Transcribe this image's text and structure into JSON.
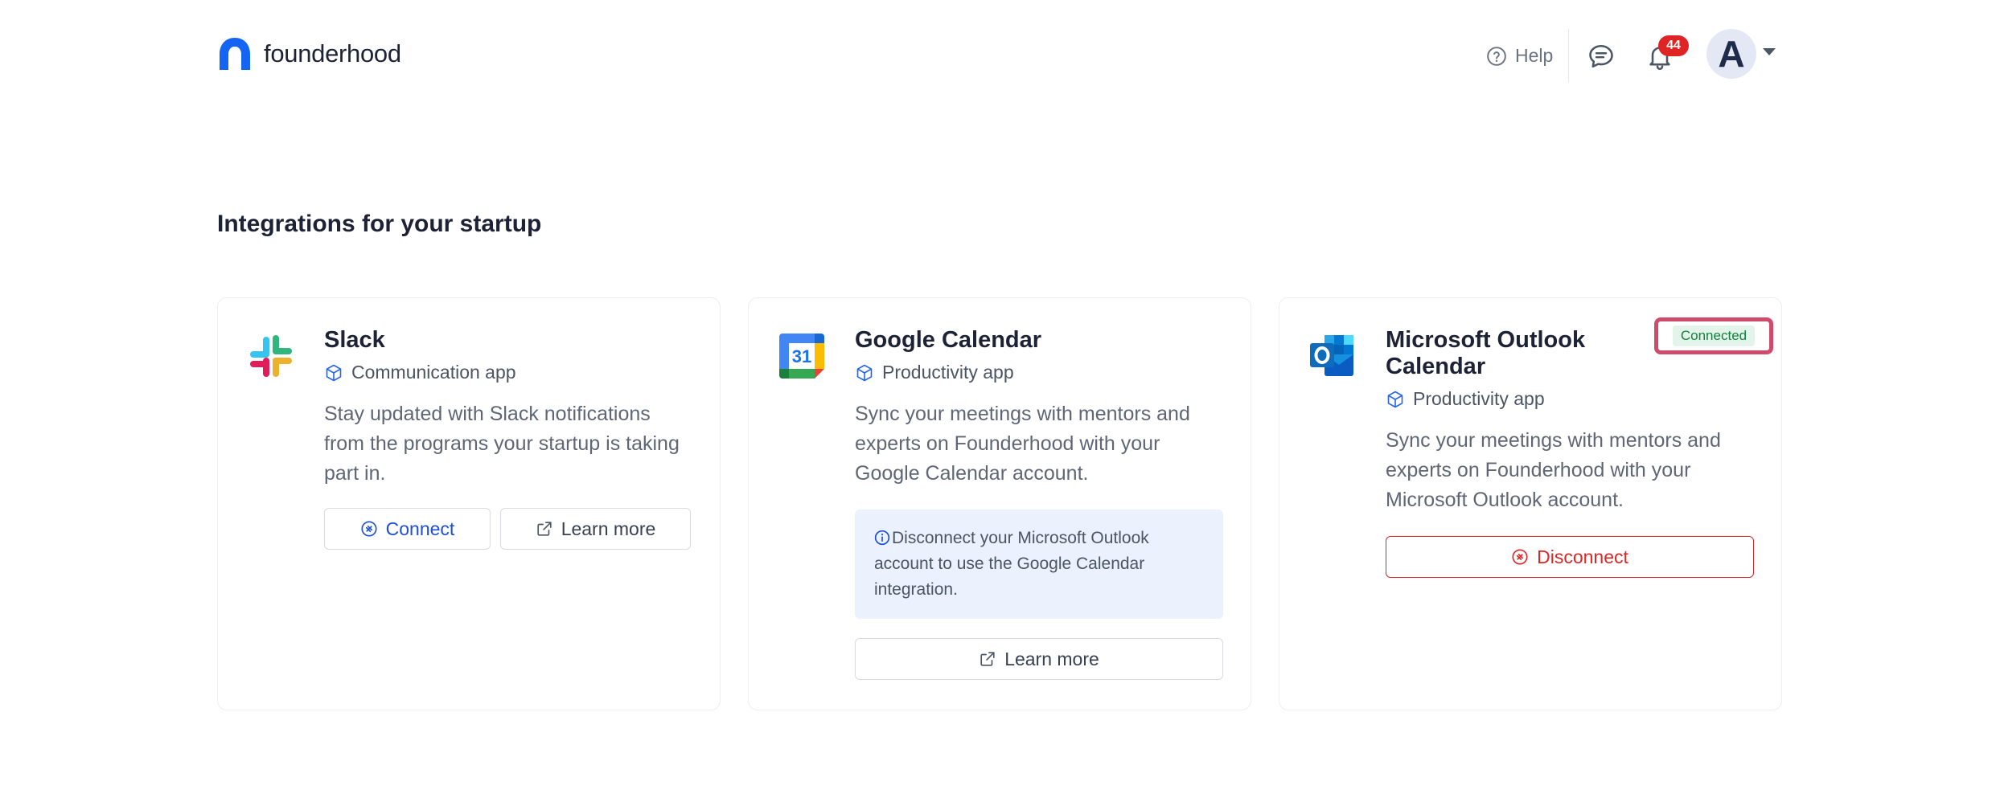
{
  "header": {
    "brand": "founderhood",
    "help_label": "Help",
    "notification_count": "44",
    "avatar_initial": "A"
  },
  "page": {
    "title": "Integrations for your startup"
  },
  "integrations": [
    {
      "name": "Slack",
      "type": "Communication app",
      "description": "Stay updated with Slack notifications from the programs your startup is taking part in.",
      "connect_label": "Connect",
      "learn_more_label": "Learn more"
    },
    {
      "name": "Google Calendar",
      "type": "Productivity app",
      "icon_text": "31",
      "description": "Sync your meetings with mentors and experts on Founderhood with your Google Calendar account.",
      "info": "Disconnect your Microsoft Outlook account to use the Google Calendar integration.",
      "learn_more_label": "Learn more"
    },
    {
      "name": "Microsoft Outlook Calendar",
      "type": "Productivity app",
      "status": "Connected",
      "description": "Sync your meetings with mentors and experts on Founderhood with your Microsoft Outlook account.",
      "disconnect_label": "Disconnect"
    }
  ],
  "colors": {
    "brand_blue": "#1565f5",
    "link_blue": "#1d4ed8",
    "danger_red": "#dc2626",
    "badge_red": "#e02424",
    "connected_green": "#15803d",
    "highlight_frame": "#cf4a6b"
  }
}
